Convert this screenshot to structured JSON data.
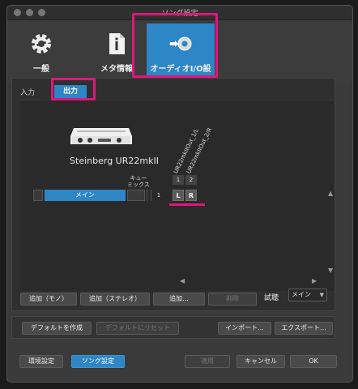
{
  "window": {
    "title": "ソング設定"
  },
  "toolbar": {
    "general": {
      "label": "一般",
      "icon": "gear-icon"
    },
    "meta": {
      "label": "メタ情報",
      "icon": "info-document-icon"
    },
    "audio_io": {
      "label": "オーディオI/O設定",
      "icon": "speaker-connector-icon"
    }
  },
  "tabs": {
    "input": "入力",
    "output": "出力"
  },
  "device": {
    "name": "Steinberg UR22mkII",
    "icon": "audio-interface-icon"
  },
  "channel_headers": [
    "UR22mkIIOut_1/L",
    "UR22mkIIOut_2/R"
  ],
  "cue_mix": "キュー\nミックス",
  "channels": {
    "nums": [
      "1",
      "2"
    ],
    "buttons": [
      "L",
      "R"
    ]
  },
  "row": {
    "main_label": "メイン",
    "cue_number": "1"
  },
  "buttons": {
    "add_mono": "追加（モノ）",
    "add_stereo": "追加（ステレオ）",
    "add": "追加...",
    "delete": "削除",
    "listen_label": "試聴",
    "listen_select": "メイン",
    "make_default": "デフォルトを作成",
    "reset_default": "デフォルトにリセット",
    "import": "インポート...",
    "export": "エクスポート...",
    "env_settings": "環境設定",
    "song_settings": "ソング設定",
    "apply": "適用",
    "cancel": "キャンセル",
    "ok": "OK"
  },
  "colors": {
    "accent": "#2d86c6",
    "highlight": "#e0167d"
  }
}
